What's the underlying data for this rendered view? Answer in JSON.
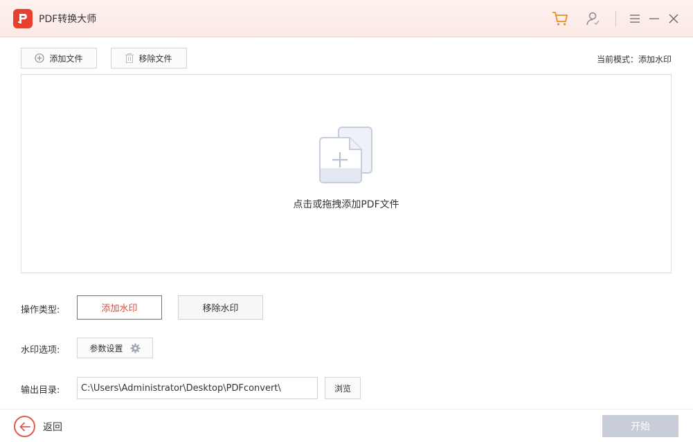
{
  "app": {
    "title": "PDF转换大师",
    "logo_letter": "P"
  },
  "titlebar": {
    "icons": [
      "cart-icon",
      "user-icon",
      "menu-icon",
      "minimize-icon",
      "close-icon"
    ]
  },
  "toolbar": {
    "add_file": "添加文件",
    "remove_file": "移除文件"
  },
  "mode": {
    "text": "当前模式：添加水印"
  },
  "dropzone": {
    "text": "点击或拖拽添加PDF文件"
  },
  "operation": {
    "label": "操作类型:",
    "options": [
      "添加水印",
      "移除水印"
    ],
    "selected": "添加水印"
  },
  "watermark": {
    "label": "水印选项:",
    "settings_button": "参数设置"
  },
  "output": {
    "label": "输出目录:",
    "path": "C:\\Users\\Administrator\\Desktop\\PDFconvert\\",
    "browse": "浏览"
  },
  "footer": {
    "back": "返回",
    "start": "开始"
  },
  "colors": {
    "accent": "#e8402e",
    "active_border": "#d34a3e",
    "start_disabled": "#c8cdd9"
  }
}
